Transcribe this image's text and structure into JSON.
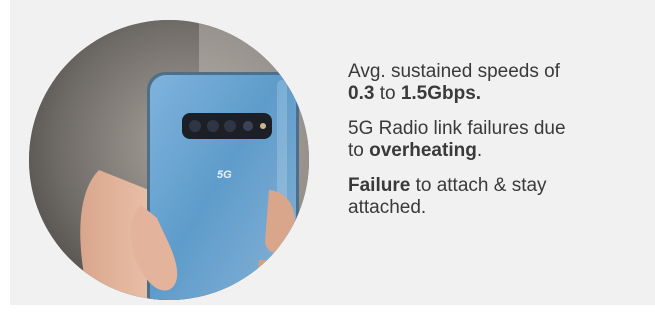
{
  "colors": {
    "panel_background": "#f1f1f1",
    "text": "#3a3a3a",
    "phone_body": "#5f9cc8"
  },
  "photo": {
    "subject": "phone-in-hand",
    "phone_mark": "5G"
  },
  "bullets": [
    {
      "line1": "Avg. sustained speeds of",
      "bold1": "0.3",
      "mid": " to ",
      "bold2": "1.5Gbps."
    },
    {
      "line1": "5G Radio link failures due",
      "pre": "to ",
      "bold": "overheating",
      "post": "."
    },
    {
      "bold": "Failure",
      "line1_rest": " to attach & stay",
      "line2": "attached."
    }
  ]
}
